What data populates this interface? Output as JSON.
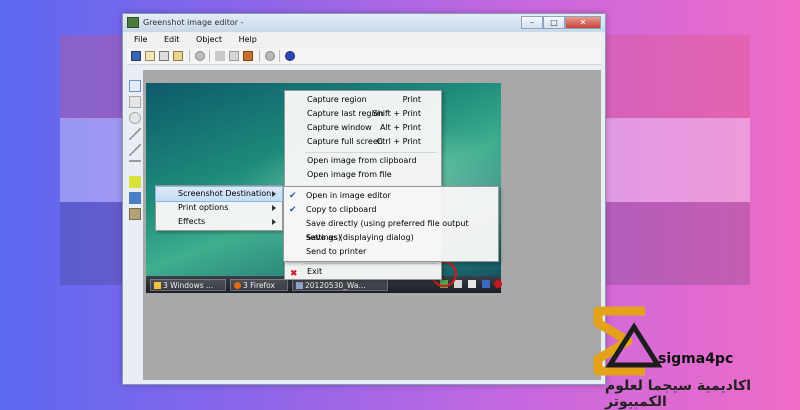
{
  "window": {
    "title": "Greenshot image editor -",
    "controls": {
      "minimize": "–",
      "maximize": "□",
      "close": "✕"
    }
  },
  "menubar": [
    "File",
    "Edit",
    "Object",
    "Help"
  ],
  "toolbar_icons": [
    "save-icon",
    "clipboard-icon",
    "print-icon",
    "email-icon",
    "delete-icon",
    "cut-icon",
    "copy-icon",
    "paste-icon",
    "settings-icon",
    "help-icon"
  ],
  "left_tools": [
    "pointer-tool-icon",
    "rectangle-tool-icon",
    "ellipse-tool-icon",
    "line-tool-icon",
    "arrow-tool-icon",
    "text-tool-icon",
    "highlight-tool-icon",
    "obfuscate-tool-icon",
    "crop-tool-icon"
  ],
  "taskbar": {
    "items": [
      "3 Windows ...",
      "3 Firefox",
      "20120530_Wa..."
    ]
  },
  "context_menu": {
    "capture_items": [
      {
        "label": "Capture region",
        "shortcut": "Print"
      },
      {
        "label": "Capture last region",
        "shortcut": "Shift + Print"
      },
      {
        "label": "Capture window",
        "shortcut": "Alt + Print"
      },
      {
        "label": "Capture full screen",
        "shortcut": "Ctrl + Print"
      }
    ],
    "open_items": [
      "Open image from clipboard",
      "Open image from file"
    ],
    "exit": "Exit"
  },
  "submenu_left": [
    "Screenshot Destination",
    "Print options",
    "Effects"
  ],
  "destination_menu": [
    {
      "label": "Open in image editor",
      "checked": true
    },
    {
      "label": "Copy to clipboard",
      "checked": true
    },
    {
      "label": "Save directly (using preferred file output settings)",
      "checked": false
    },
    {
      "label": "Save as (displaying dialog)",
      "checked": false
    },
    {
      "label": "Send to printer",
      "checked": false
    }
  ],
  "branding": {
    "name": "sigma4pc",
    "arabic": "اكاديمية سيجما لعلوم الكمبيوتر"
  },
  "colors": {
    "accent_red": "#d21c1c",
    "logo_gold": "#e3a21a",
    "highlight": "#c3dcf5"
  }
}
